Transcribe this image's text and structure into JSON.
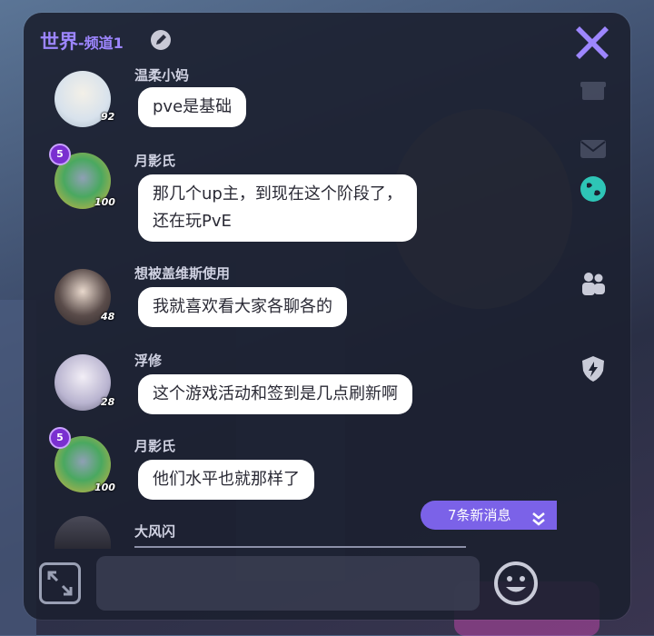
{
  "header": {
    "title_main": "世界",
    "title_sub": "-频道1"
  },
  "messages": [
    {
      "name": "温柔小妈",
      "level": "92",
      "text_lines": [
        "pve是基础"
      ]
    },
    {
      "name": "月影氏",
      "level": "100",
      "badge": "5",
      "text_lines": [
        "那几个up主，到现在这个阶段了，",
        "还在玩PvE"
      ]
    },
    {
      "name": "想被盖维斯使用",
      "level": "48",
      "text_lines": [
        "我就喜欢看大家各聊各的"
      ]
    },
    {
      "name": "浮修",
      "level": "28",
      "text_lines": [
        "这个游戏活动和签到是几点刷新啊"
      ]
    },
    {
      "name": "月影氏",
      "level": "100",
      "badge": "5",
      "text_lines": [
        "他们水平也就那样了"
      ]
    },
    {
      "name": "大风闪",
      "level": "",
      "text_lines": []
    }
  ],
  "new_messages": {
    "label": "7条新消息"
  },
  "colors": {
    "accent": "#9d86ff",
    "panel": "#1c2030",
    "new_msg_bg": "#7b62e8",
    "bubble": "#ffffff",
    "globe_active": "#2ec5b6"
  },
  "icons": [
    "edit-icon",
    "close-icon",
    "gift-icon",
    "mail-icon",
    "globe-icon",
    "users-icon",
    "shield-bolt-icon",
    "expand-icon",
    "emoji-icon",
    "chevron-double-down-icon"
  ]
}
